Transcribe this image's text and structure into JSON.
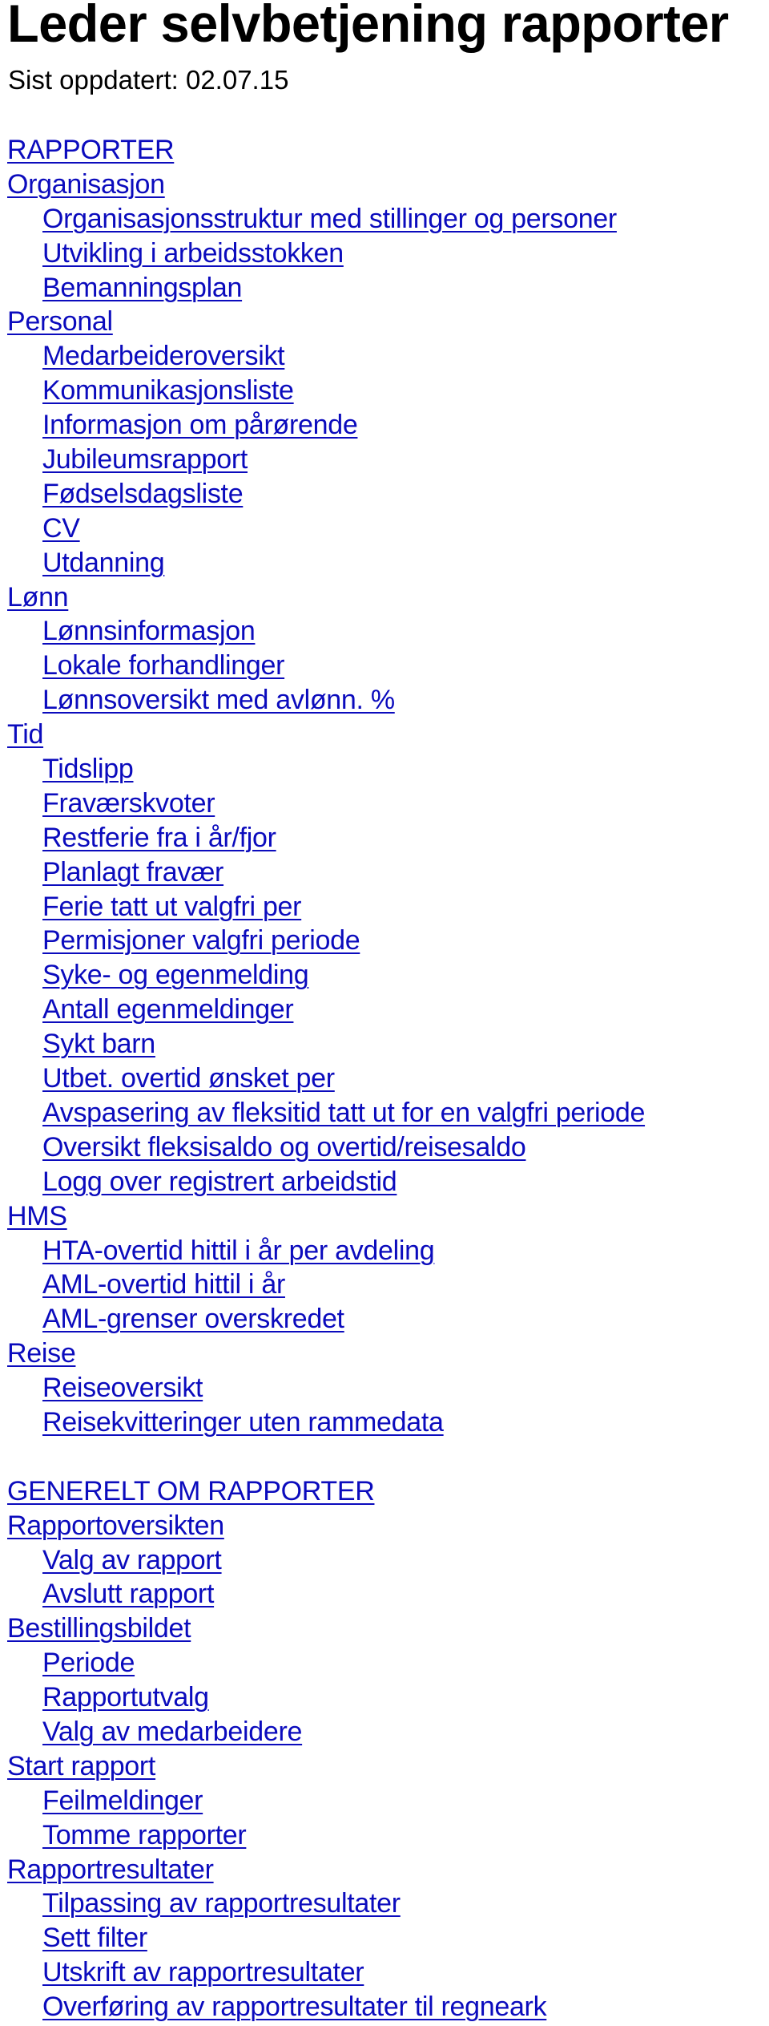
{
  "document": {
    "title": "Leder selvbetjening rapporter",
    "updated": "Sist oppdatert: 02.07.15"
  },
  "colors": {
    "link": "#0b0bbd",
    "text": "#000000",
    "background": "#ffffff"
  },
  "toc": [
    {
      "level": 0,
      "label": "RAPPORTER"
    },
    {
      "level": 0,
      "label": "Organisasjon"
    },
    {
      "level": 1,
      "label": "Organisasjonsstruktur med stillinger og personer"
    },
    {
      "level": 1,
      "label": "Utvikling i arbeidsstokken"
    },
    {
      "level": 1,
      "label": "Bemanningsplan"
    },
    {
      "level": 0,
      "label": "Personal"
    },
    {
      "level": 1,
      "label": "Medarbeideroversikt"
    },
    {
      "level": 1,
      "label": "Kommunikasjonsliste"
    },
    {
      "level": 1,
      "label": "Informasjon om pårørende"
    },
    {
      "level": 1,
      "label": "Jubileumsrapport"
    },
    {
      "level": 1,
      "label": "Fødselsdagsliste"
    },
    {
      "level": 1,
      "label": "CV"
    },
    {
      "level": 1,
      "label": "Utdanning"
    },
    {
      "level": 0,
      "label": "Lønn"
    },
    {
      "level": 1,
      "label": "Lønnsinformasjon"
    },
    {
      "level": 1,
      "label": "Lokale forhandlinger"
    },
    {
      "level": 1,
      "label": "Lønnsoversikt med avlønn. %"
    },
    {
      "level": 0,
      "label": "Tid"
    },
    {
      "level": 1,
      "label": "Tidslipp"
    },
    {
      "level": 1,
      "label": "Fraværskvoter"
    },
    {
      "level": 1,
      "label": "Restferie fra i år/fjor"
    },
    {
      "level": 1,
      "label": "Planlagt fravær"
    },
    {
      "level": 1,
      "label": "Ferie tatt ut valgfri per"
    },
    {
      "level": 1,
      "label": "Permisjoner valgfri periode"
    },
    {
      "level": 1,
      "label": "Syke- og egenmelding"
    },
    {
      "level": 1,
      "label": "Antall egenmeldinger"
    },
    {
      "level": 1,
      "label": "Sykt barn"
    },
    {
      "level": 1,
      "label": "Utbet. overtid ønsket per"
    },
    {
      "level": 1,
      "label": "Avspasering av fleksitid tatt ut for en valgfri periode"
    },
    {
      "level": 1,
      "label": "Oversikt fleksisaldo og overtid/reisesaldo"
    },
    {
      "level": 1,
      "label": "Logg over registrert arbeidstid"
    },
    {
      "level": 0,
      "label": "HMS"
    },
    {
      "level": 1,
      "label": "HTA-overtid hittil i år per avdeling"
    },
    {
      "level": 1,
      "label": "AML-overtid hittil i år"
    },
    {
      "level": 1,
      "label": "AML-grenser overskredet"
    },
    {
      "level": 0,
      "label": "Reise"
    },
    {
      "level": 1,
      "label": "Reiseoversikt"
    },
    {
      "level": 1,
      "label": "Reisekvitteringer uten rammedata"
    },
    {
      "level": -1,
      "label": ""
    },
    {
      "level": 0,
      "label": "GENERELT OM RAPPORTER"
    },
    {
      "level": 0,
      "label": "Rapportoversikten"
    },
    {
      "level": 1,
      "label": "Valg av rapport"
    },
    {
      "level": 1,
      "label": "Avslutt rapport"
    },
    {
      "level": 0,
      "label": "Bestillingsbildet"
    },
    {
      "level": 1,
      "label": "Periode"
    },
    {
      "level": 1,
      "label": "Rapportutvalg"
    },
    {
      "level": 1,
      "label": "Valg av medarbeidere"
    },
    {
      "level": 0,
      "label": "Start rapport"
    },
    {
      "level": 1,
      "label": "Feilmeldinger"
    },
    {
      "level": 1,
      "label": "Tomme rapporter"
    },
    {
      "level": 0,
      "label": "Rapportresultater"
    },
    {
      "level": 1,
      "label": "Tilpassing av rapportresultater"
    },
    {
      "level": 1,
      "label": "Sett filter"
    },
    {
      "level": 1,
      "label": "Utskrift av rapportresultater"
    },
    {
      "level": 1,
      "label": "Overføring av rapportresultater til regneark"
    }
  ]
}
